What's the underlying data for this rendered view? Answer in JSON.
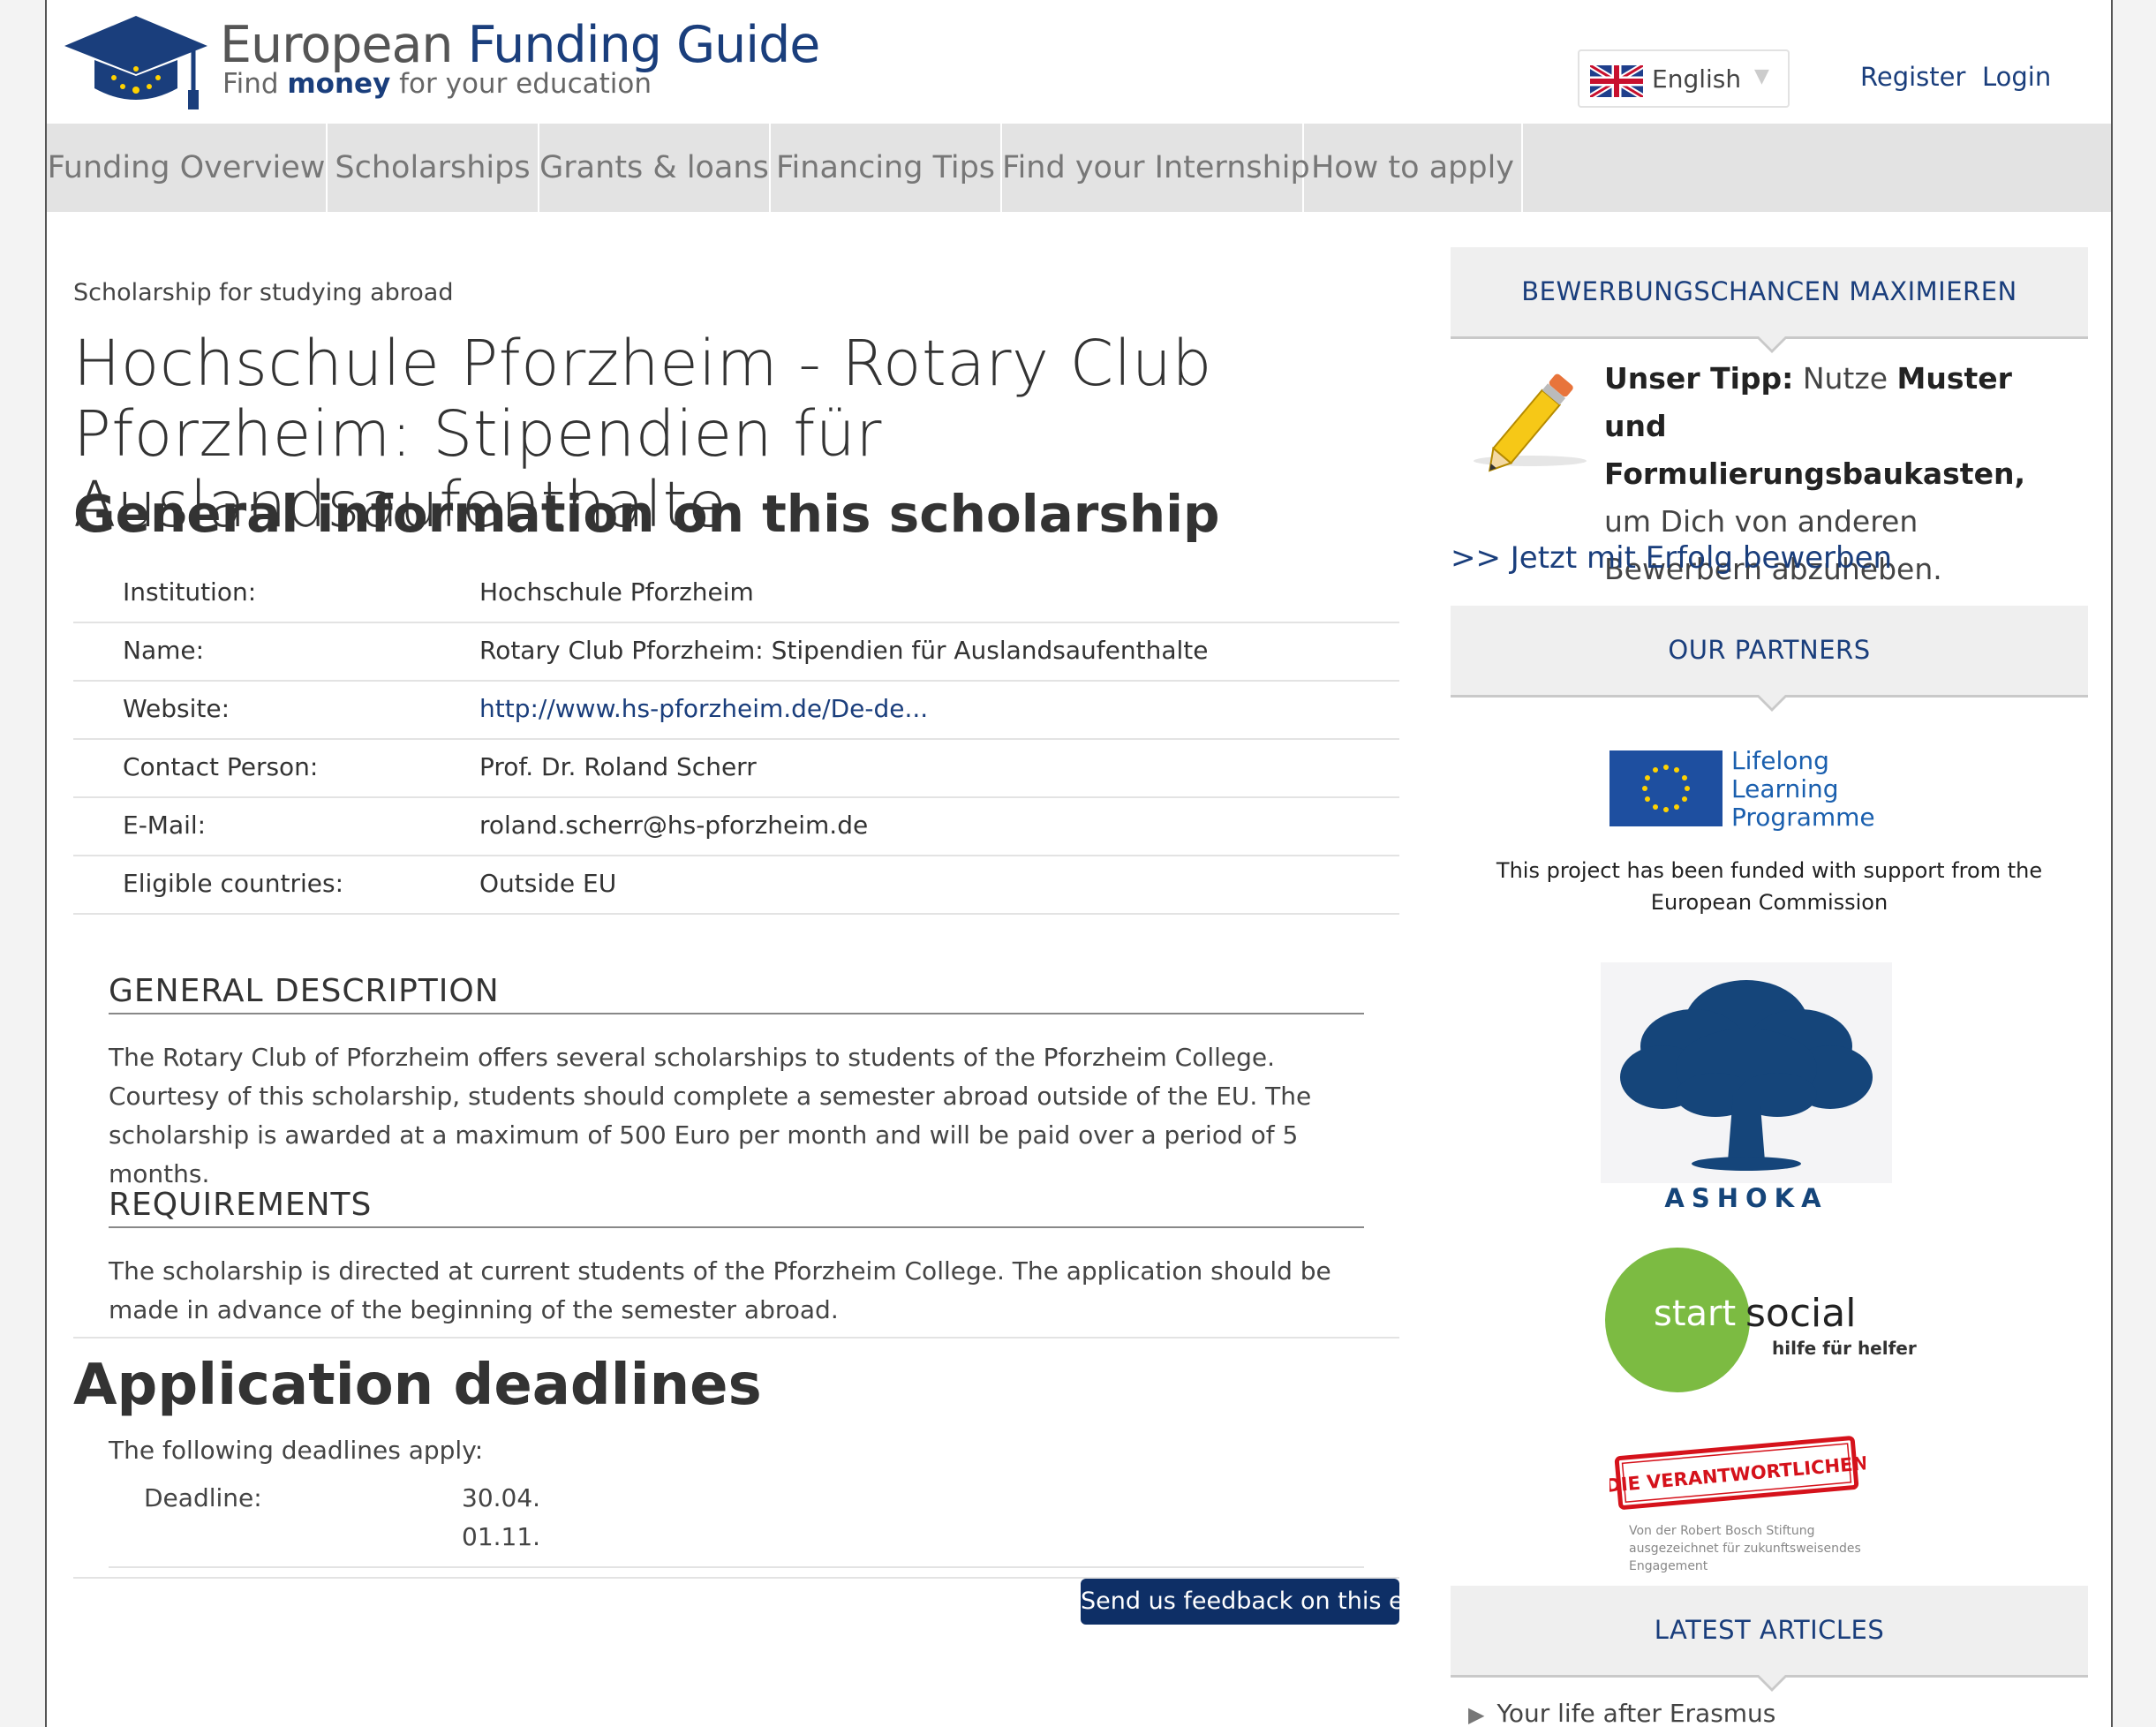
{
  "brand": {
    "title_part1": "European ",
    "title_part2": "Funding Guide",
    "sub_part1": "Find ",
    "sub_bold": "money",
    "sub_part2": " for your education"
  },
  "header": {
    "language": "English",
    "register": "Register",
    "login": "Login"
  },
  "nav": {
    "items": [
      "Funding Overview",
      "Scholarships",
      "Grants & loans",
      "Financing Tips",
      "Find your Internship",
      "How to apply"
    ]
  },
  "main": {
    "breadcrumb": "Scholarship for studying abroad",
    "title": "Hochschule Pforzheim - Rotary Club Pforzheim: Stipendien für Auslandsaufenthalte",
    "subtitle": "General information on this scholarship",
    "info": [
      {
        "label": "Institution:",
        "value": "Hochschule Pforzheim"
      },
      {
        "label": "Name:",
        "value": "Rotary Club Pforzheim: Stipendien für Auslandsaufenthalte"
      },
      {
        "label": "Website:",
        "value": "http://www.hs-pforzheim.de/De-de..."
      },
      {
        "label": "Contact Person:",
        "value": "Prof. Dr. Roland Scherr"
      },
      {
        "label": "E-Mail:",
        "value": "roland.scherr@hs-pforzheim.de"
      },
      {
        "label": "Eligible countries:",
        "value": "Outside EU"
      }
    ],
    "general_heading": "GENERAL DESCRIPTION",
    "general_text": "The Rotary Club of Pforzheim offers several scholarships to students of the Pforzheim College. Courtesy of this scholarship, students should complete a semester abroad outside of the EU. The scholarship is awarded at a maximum of 500 Euro per month and will be paid over a period of 5 months.",
    "requirements_heading": "REQUIREMENTS",
    "requirements_text": "The scholarship is directed at current students of the Pforzheim College. The application should be made in advance of the beginning of the semester abroad.",
    "deadlines_heading": "Application deadlines",
    "deadlines_intro": "The following deadlines apply:",
    "deadline_label": "Deadline:",
    "deadline_dates": [
      "30.04.",
      "01.11."
    ],
    "feedback_button": "Send us feedback on this entry"
  },
  "sidebar": {
    "box1_title": "BEWERBUNGSCHANCEN MAXIMIEREN",
    "tip_bold1": "Unser Tipp:",
    "tip_text1": " Nutze ",
    "tip_bold2": "Muster und Formulierungsbaukasten,",
    "tip_text2": " um Dich von anderen Bewerbern abzuheben.",
    "apply_link": ">> Jetzt mit Erfolg bewerben",
    "partners_title": "OUR PARTNERS",
    "llp_line1": "Lifelong",
    "llp_line2": "Learning",
    "llp_line3": "Programme",
    "funded_text": "This project has been funded with support from the European Commission",
    "ashoka_label": "ASHOKA",
    "startsocial_start": "start",
    "startsocial_social": "social",
    "startsocial_tag": "hilfe für helfer",
    "verantwortlichen": "DIE VERANTWORTLICHEN",
    "bosch_text": "Von der Robert Bosch Stiftung ausgezeichnet für zukunftsweisendes Engagement",
    "articles_title": "LATEST ARTICLES",
    "article1": "Your life after Erasmus"
  },
  "colors": {
    "brand_blue": "#1a3e7c",
    "button_navy": "#0e2f66",
    "nav_bg": "#e3e3e3",
    "startsocial_green": "#7cbb42",
    "eu_blue": "#1e4fa0",
    "eu_yellow": "#ffd200"
  }
}
